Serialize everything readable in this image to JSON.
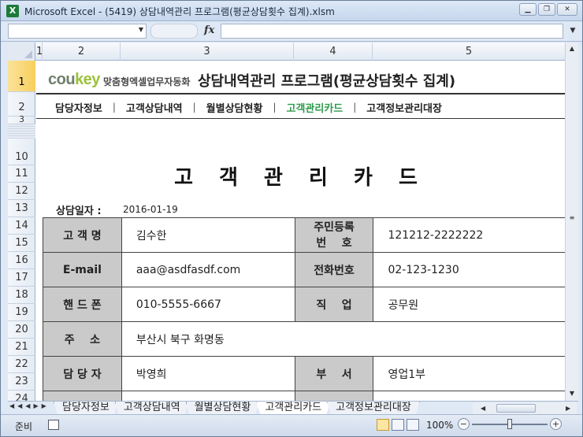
{
  "window": {
    "title": "Microsoft Excel - (5419) 상담내역관리 프로그램(평균상담횟수 집계).xlsm",
    "app_icon": "X",
    "buttons": [
      "minimize",
      "restore",
      "close"
    ]
  },
  "formula_bar": {
    "name_box": "",
    "fx": "fx",
    "content": ""
  },
  "columns": [
    "1",
    "2",
    "3",
    "4",
    "5"
  ],
  "rows": [
    {
      "label": "1",
      "active": true
    },
    {
      "label": "2",
      "active": false
    },
    {
      "label": "3",
      "active": false
    },
    {
      "label": "10",
      "active": false
    },
    {
      "label": "11",
      "active": false
    },
    {
      "label": "12",
      "active": false
    },
    {
      "label": "13",
      "active": false
    },
    {
      "label": "14",
      "active": false
    },
    {
      "label": "15",
      "active": false
    },
    {
      "label": "16",
      "active": false
    },
    {
      "label": "17",
      "active": false
    },
    {
      "label": "18",
      "active": false
    },
    {
      "label": "19",
      "active": false
    },
    {
      "label": "20",
      "active": false
    },
    {
      "label": "21",
      "active": false
    },
    {
      "label": "22",
      "active": false
    },
    {
      "label": "23",
      "active": false
    },
    {
      "label": "24",
      "active": false
    }
  ],
  "header": {
    "logo_main": "cou",
    "logo_accent": "key",
    "logo_tag": "맞춤형엑셀업무자동화",
    "title": "상담내역관리 프로그램(평균상담횟수 집계)"
  },
  "nav": {
    "items": [
      "담당자정보",
      "고객상담내역",
      "월별상담현황",
      "고객관리카드",
      "고객정보관리대장"
    ],
    "current_index": 3,
    "separator": "|"
  },
  "card": {
    "title": "고 객 관 리 카 드",
    "date_label": "상담일자 :",
    "date_value": "2016-01-19",
    "fields": {
      "name_label": "고 객 명",
      "name_value": "김수한",
      "rrn_label_1": "주민등록",
      "rrn_label_2": "번    호",
      "rrn_value": "121212-2222222",
      "email_label": "E-mail",
      "email_value": "aaa@asdfasdf.com",
      "phone_label": "전화번호",
      "phone_value": "02-123-1230",
      "mobile_label": "핸 드 폰",
      "mobile_value": "010-5555-6667",
      "job_label": "직    업",
      "job_value": "공무원",
      "address_label": "주    소",
      "address_value": "부산시 북구 화명동",
      "manager_label": "담 당 자",
      "manager_value": "박영희",
      "dept_label": "부    서",
      "dept_value": "영업1부"
    }
  },
  "sheet_tabs": [
    "담당자정보",
    "고객상담내역",
    "월별상담현황",
    "고객관리카드",
    "고객정보관리대장"
  ],
  "active_tab_index": 3,
  "status": {
    "ready": "준비",
    "zoom": "100%"
  },
  "colors": {
    "nav_current": "#2e9a4c",
    "label_bg": "#cacaca",
    "logo_accent": "#9bc23c",
    "row_active": "#f8cf5c"
  }
}
